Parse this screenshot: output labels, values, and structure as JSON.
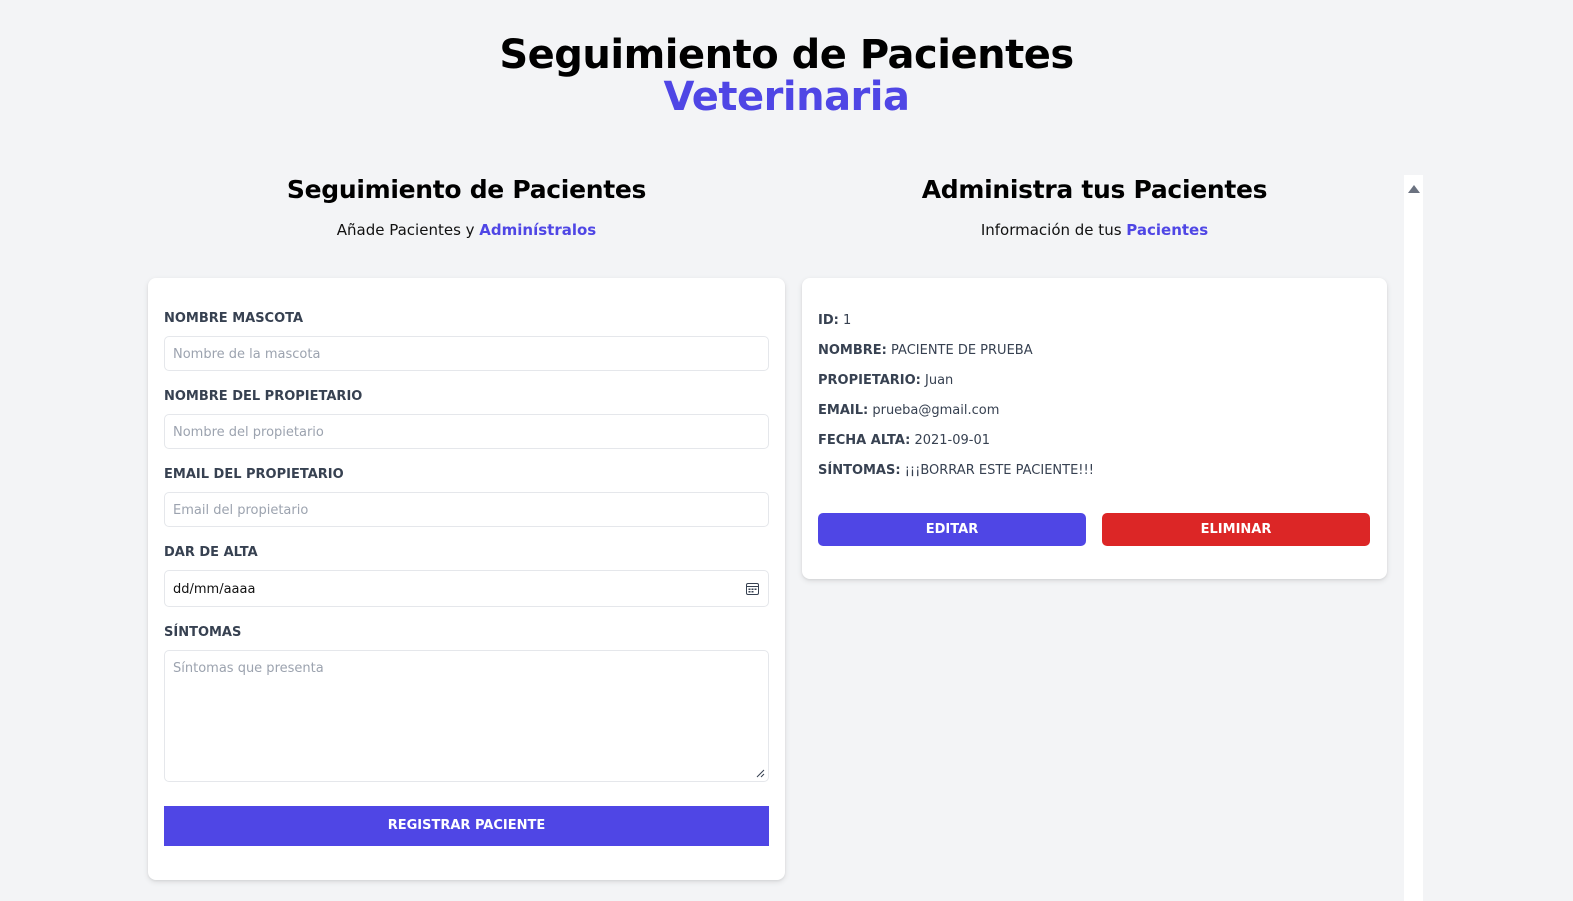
{
  "header": {
    "title": "Seguimiento de Pacientes",
    "accent": "Veterinaria"
  },
  "form_section": {
    "title": "Seguimiento de Pacientes",
    "subtitle_prefix": "Añade Pacientes y ",
    "subtitle_highlight": "Adminístralos"
  },
  "list_section": {
    "title": "Administra tus Pacientes",
    "subtitle_prefix": "Información de tus ",
    "subtitle_highlight": "Pacientes"
  },
  "form": {
    "pet_label": "Nombre Mascota",
    "pet_placeholder": "Nombre de la mascota",
    "owner_label": "Nombre del Propietario",
    "owner_placeholder": "Nombre del propietario",
    "email_label": "Email del Propietario",
    "email_placeholder": "Email del propietario",
    "date_label": "Dar de Alta",
    "date_value": "dd/mm/aaaa",
    "symptoms_label": "Síntomas",
    "symptoms_placeholder": "Síntomas que presenta",
    "submit_label": "Registrar Paciente"
  },
  "patient": {
    "id_label": "ID:",
    "id_value": "1",
    "name_label": "Nombre:",
    "name_value": "PACIENTE DE PRUEBA",
    "owner_label": "Propietario:",
    "owner_value": "Juan",
    "email_label": "Email:",
    "email_value": "prueba@gmail.com",
    "date_label": "Fecha Alta:",
    "date_value": "2021-09-01",
    "symptoms_label": "Síntomas:",
    "symptoms_value": "¡¡¡BORRAR ESTE PACIENTE!!!",
    "edit_label": "Editar",
    "delete_label": "Eliminar"
  },
  "colors": {
    "accent": "#4f46e5",
    "danger": "#dc2626",
    "background": "#f3f4f6"
  },
  "icons": {
    "date": "calendar-icon",
    "resize": "resize-grip-icon",
    "scroll": "scroll-up-arrow-icon"
  }
}
